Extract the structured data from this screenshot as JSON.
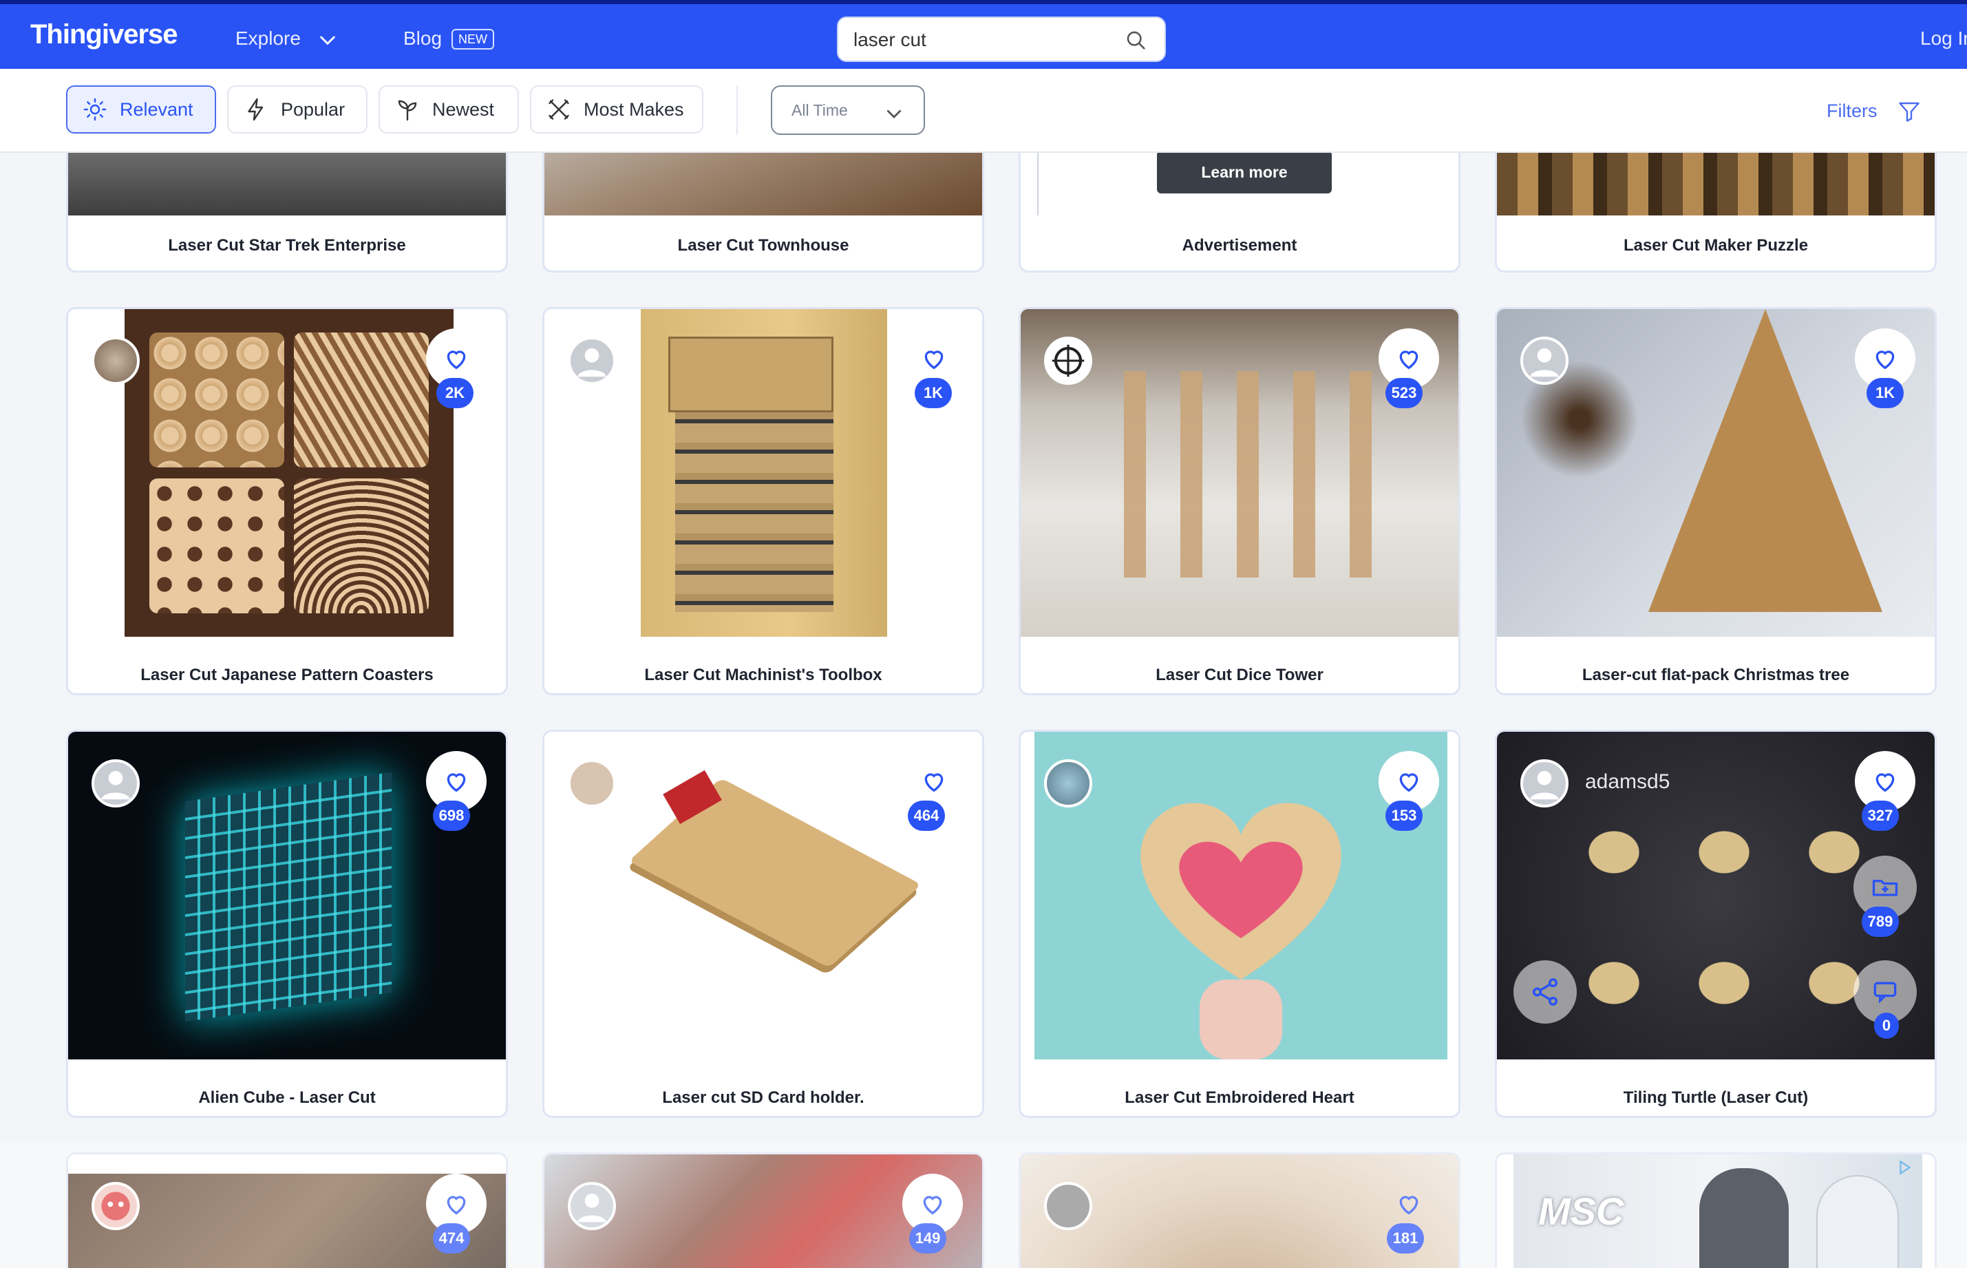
{
  "header": {
    "logo": "Thingiverse",
    "explore": "Explore",
    "blog": "Blog",
    "blog_badge": "NEW",
    "search_value": "laser cut",
    "login": "Log In",
    "colors": {
      "brand": "#2a53f5",
      "accent": "#4a6cf0"
    }
  },
  "sort": {
    "relevant": "Relevant",
    "popular": "Popular",
    "newest": "Newest",
    "most_makes": "Most Makes",
    "time_selected": "All Time",
    "filters": "Filters"
  },
  "row0": [
    {
      "title": "Laser Cut Star Trek Enterprise"
    },
    {
      "title": "Laser Cut Townhouse"
    },
    {
      "title": "Advertisement",
      "button": "Learn more"
    },
    {
      "title": "Laser Cut Maker Puzzle"
    }
  ],
  "row1": [
    {
      "title": "Laser Cut Japanese Pattern Coasters",
      "likes": "2K"
    },
    {
      "title": "Laser Cut Machinist's Toolbox",
      "likes": "1K"
    },
    {
      "title": "Laser Cut Dice Tower",
      "likes": "523"
    },
    {
      "title": "Laser-cut flat-pack Christmas tree",
      "likes": "1K"
    }
  ],
  "row2": [
    {
      "title": "Alien Cube - Laser Cut",
      "likes": "698"
    },
    {
      "title": "Laser cut SD Card holder.",
      "likes": "464"
    },
    {
      "title": "Laser Cut Embroidered Heart",
      "likes": "153"
    },
    {
      "title": "Tiling Turtle (Laser Cut)",
      "likes": "327",
      "author": "adamsd5",
      "collections": "789",
      "comments": "0"
    }
  ],
  "row3": [
    {
      "likes": "474"
    },
    {
      "likes": "149"
    },
    {
      "likes": "181"
    },
    {
      "ad_text": "MSC"
    }
  ]
}
